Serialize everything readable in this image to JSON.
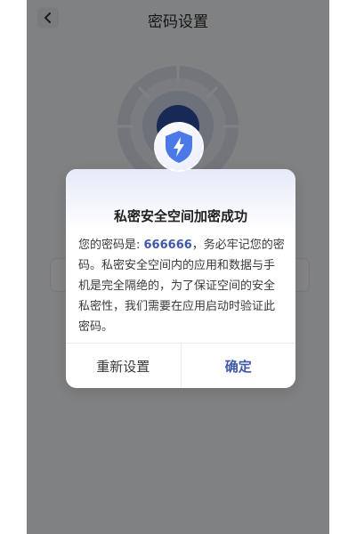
{
  "header": {
    "title": "密码设置",
    "back_icon": "chevron-left-icon"
  },
  "dialog": {
    "icon": "shield-lightning-icon",
    "title": "私密安全空间加密成功",
    "message_prefix": "您的密码是: ",
    "password": "666666",
    "message_suffix": "，务必牢记您的密码。私密安全空间内的应用和数据与手机是完全隔绝的，为了保证空间的安全私密性，我们需要在应用启动时验证此密码。",
    "reset_label": "重新设置",
    "confirm_label": "确定"
  },
  "colors": {
    "accent": "#3f59a8",
    "shield": "#4b79e8",
    "overlay": "rgba(0,0,0,0.47)"
  }
}
